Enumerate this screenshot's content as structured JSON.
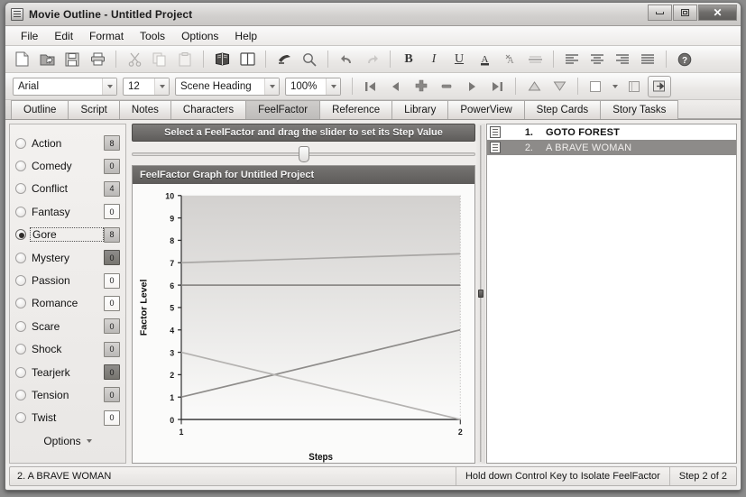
{
  "window": {
    "title": "Movie Outline - Untitled Project",
    "app_icon": "notebook-icon",
    "buttons": {
      "minimize": "minimize",
      "maximize": "maximize",
      "close": "close"
    }
  },
  "menubar": {
    "items": [
      {
        "label": "File"
      },
      {
        "label": "Edit"
      },
      {
        "label": "Format"
      },
      {
        "label": "Tools"
      },
      {
        "label": "Options"
      },
      {
        "label": "Help"
      }
    ]
  },
  "toolbar_main": {
    "groups": [
      [
        "new-document-icon",
        "open-folder-icon",
        "save-disk-icon",
        "print-icon"
      ],
      [
        "cut-scissors-icon",
        "copy-icon",
        "paste-icon"
      ],
      [
        "book-notes-icon",
        "open-book-icon"
      ],
      [
        "spellcheck-icon",
        "search-magnifier-icon"
      ],
      [
        "undo-arrow-icon",
        "redo-arrow-icon"
      ],
      [
        "bold-icon",
        "italic-icon",
        "underline-icon",
        "font-color-icon",
        "strike-format-icon",
        "strikethrough-icon"
      ],
      [
        "align-left-icon",
        "align-center-icon",
        "align-right-icon",
        "align-justify-icon"
      ],
      [
        "help-question-icon"
      ]
    ],
    "text_glyphs": {
      "bold": "B",
      "italic": "I",
      "underline": "U",
      "font_color": "A"
    }
  },
  "toolbar_format": {
    "font_family": "Arial",
    "font_size": "12",
    "element_style": "Scene Heading",
    "zoom": "100%",
    "nav_icons": [
      "first-step-icon",
      "previous-step-icon",
      "add-step-icon",
      "delete-step-icon",
      "next-step-icon",
      "last-step-icon"
    ],
    "move_icons": [
      "move-up-icon",
      "move-down-icon"
    ],
    "view_icons": [
      "color-swatch-icon",
      "card-view-icon",
      "export-icon"
    ]
  },
  "tabs": {
    "items": [
      {
        "label": "Outline",
        "active": false
      },
      {
        "label": "Script",
        "active": false
      },
      {
        "label": "Notes",
        "active": false
      },
      {
        "label": "Characters",
        "active": false
      },
      {
        "label": "FeelFactor",
        "active": true
      },
      {
        "label": "Reference",
        "active": false
      },
      {
        "label": "Library",
        "active": false
      },
      {
        "label": "PowerView",
        "active": false
      },
      {
        "label": "Step Cards",
        "active": false
      },
      {
        "label": "Story Tasks",
        "active": false
      }
    ]
  },
  "factors": {
    "items": [
      {
        "label": "Action",
        "value": "8",
        "selected": false,
        "box_style": "mid"
      },
      {
        "label": "Comedy",
        "value": "0",
        "selected": false,
        "box_style": "mid"
      },
      {
        "label": "Conflict",
        "value": "4",
        "selected": false,
        "box_style": "mid"
      },
      {
        "label": "Fantasy",
        "value": "0",
        "selected": false,
        "box_style": "light"
      },
      {
        "label": "Gore",
        "value": "8",
        "selected": true,
        "box_style": "mid"
      },
      {
        "label": "Mystery",
        "value": "0",
        "selected": false,
        "box_style": "dark"
      },
      {
        "label": "Passion",
        "value": "0",
        "selected": false,
        "box_style": "light"
      },
      {
        "label": "Romance",
        "value": "0",
        "selected": false,
        "box_style": "light"
      },
      {
        "label": "Scare",
        "value": "0",
        "selected": false,
        "box_style": "mid"
      },
      {
        "label": "Shock",
        "value": "0",
        "selected": false,
        "box_style": "mid"
      },
      {
        "label": "Tearjerk",
        "value": "0",
        "selected": false,
        "box_style": "dark"
      },
      {
        "label": "Tension",
        "value": "0",
        "selected": false,
        "box_style": "mid"
      },
      {
        "label": "Twist",
        "value": "0",
        "selected": false,
        "box_style": "light"
      }
    ],
    "options_label": "Options",
    "options_caret": "chevron-down-icon"
  },
  "slider": {
    "header_text": "Select a FeelFactor and drag the slider to set its Step Value",
    "thumb_position_percent": 50
  },
  "graph": {
    "title": "FeelFactor Graph for Untitled Project"
  },
  "chart_data": {
    "type": "line",
    "title": "FeelFactor Graph for Untitled Project",
    "xlabel": "Steps",
    "ylabel": "Factor Level",
    "x": [
      1,
      2
    ],
    "xticks": [
      "1",
      "2"
    ],
    "yticks": [
      "0",
      "1",
      "2",
      "3",
      "4",
      "5",
      "6",
      "7",
      "8",
      "9",
      "10"
    ],
    "xlim": [
      1,
      2
    ],
    "ylim": [
      0,
      10
    ],
    "grid": false,
    "legend": "none",
    "series": [
      {
        "name": "Action",
        "values": [
          7,
          7.4
        ],
        "color": "#a9a7a5"
      },
      {
        "name": "Conflict",
        "values": [
          6,
          6
        ],
        "color": "#8c8a88"
      },
      {
        "name": "Gore",
        "values": [
          1,
          4
        ],
        "color": "#8e8c8a"
      },
      {
        "name": "Scare",
        "values": [
          3,
          0
        ],
        "color": "#b4b2b0"
      }
    ]
  },
  "scenes": {
    "rows": [
      {
        "num": "1.",
        "title": "GOTO FOREST",
        "selected": false,
        "icon": "step-card-icon"
      },
      {
        "num": "2.",
        "title": "A BRAVE WOMAN",
        "selected": true,
        "icon": "step-card-icon"
      }
    ]
  },
  "statusbar": {
    "current_scene": "2. A BRAVE WOMAN",
    "hint": "Hold down Control Key to Isolate FeelFactor",
    "step_counter": "Step 2 of 2"
  }
}
